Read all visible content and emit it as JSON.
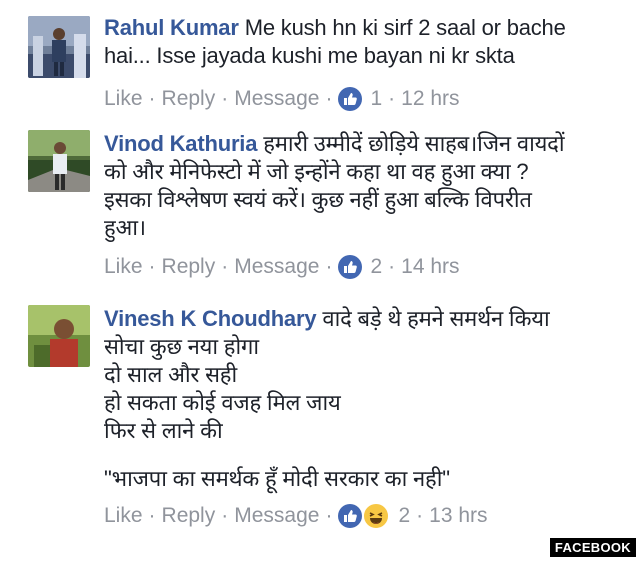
{
  "actions": {
    "like": "Like",
    "reply": "Reply",
    "message": "Message",
    "sep": "·"
  },
  "comments": [
    {
      "author": "Rahul Kumar",
      "lines": [
        "Me kush hn ki sirf 2 saal or bache",
        "hai... Isse jayada kushi me bayan ni kr skta"
      ],
      "reaction_count": "1",
      "time": "12 hrs",
      "reactions": [
        "like-icon"
      ]
    },
    {
      "author": "Vinod Kathuria",
      "lines": [
        "हमारी उम्मीदें छोड़िये साहब।जिन वायदों",
        "को और मेनिफेस्टो में जो इन्होंने कहा था वह हुआ क्या ?",
        "इसका विश्लेषण स्वयं करें। कुछ नहीं हुआ बल्कि विपरीत",
        "हुआ।"
      ],
      "reaction_count": "2",
      "time": "14 hrs",
      "reactions": [
        "like-icon"
      ]
    },
    {
      "author": "Vinesh K Choudhary",
      "lines": [
        "वादे बड़े थे हमने समर्थन किया",
        "सोचा कुछ नया होगा",
        "दो साल और सही",
        "हो सकता कोई वजह मिल जाय",
        "फिर से लाने की"
      ],
      "quote": "\"भाजपा का समर्थक हूँ मोदी सरकार का नही\"",
      "reaction_count": "2",
      "time": "13 hrs",
      "reactions": [
        "like-icon",
        "haha-icon"
      ]
    }
  ],
  "watermark": "FACEBOOK",
  "colors": {
    "link": "#365899",
    "meta": "#90949c",
    "like": "#4267b2",
    "haha": "#f7c744"
  }
}
